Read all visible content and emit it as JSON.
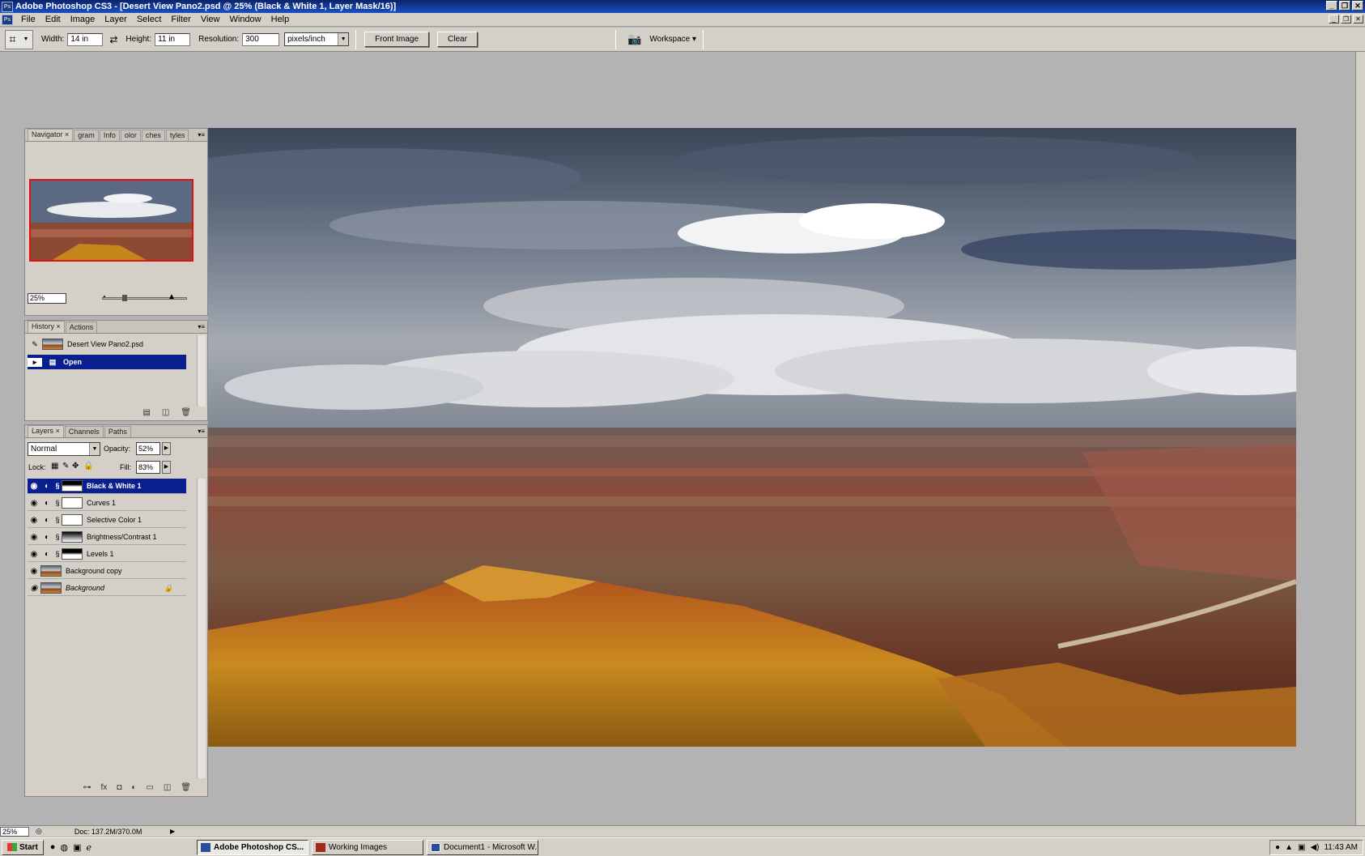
{
  "window": {
    "title": "Adobe Photoshop CS3 - [Desert View Pano2.psd @ 25% (Black & White 1, Layer Mask/16)]",
    "app_icon": "ps-icon"
  },
  "menu": [
    "File",
    "Edit",
    "Image",
    "Layer",
    "Select",
    "Filter",
    "View",
    "Window",
    "Help"
  ],
  "options": {
    "width_label": "Width:",
    "width_value": "14 in",
    "height_label": "Height:",
    "height_value": "11 in",
    "resolution_label": "Resolution:",
    "resolution_value": "300",
    "units": "pixels/inch",
    "front_image": "Front Image",
    "clear": "Clear",
    "workspace": "Workspace ▾"
  },
  "navigator": {
    "tabs": [
      "Navigator",
      "gram",
      "Info",
      "olor",
      "ches",
      "tyles"
    ],
    "zoom": "25%"
  },
  "history": {
    "tabs": [
      "History",
      "Actions"
    ],
    "snapshot": "Desert View Pano2.psd",
    "step": "Open"
  },
  "layers": {
    "tabs": [
      "Layers",
      "Channels",
      "Paths"
    ],
    "blend_mode": "Normal",
    "opacity_label": "Opacity:",
    "opacity_value": "52%",
    "lock_label": "Lock:",
    "fill_label": "Fill:",
    "fill_value": "83%",
    "items": [
      {
        "name": "Black & White 1"
      },
      {
        "name": "Curves 1"
      },
      {
        "name": "Selective Color 1"
      },
      {
        "name": "Brightness/Contrast 1"
      },
      {
        "name": "Levels 1"
      },
      {
        "name": "Background copy"
      },
      {
        "name": "Background"
      }
    ]
  },
  "status": {
    "zoom": "25%",
    "doc": "Doc: 137.2M/370.0M"
  },
  "taskbar": {
    "start": "Start",
    "buttons": [
      "Adobe Photoshop CS...",
      "Working Images",
      "Document1 - Microsoft W..."
    ],
    "clock": "11:43 AM"
  }
}
